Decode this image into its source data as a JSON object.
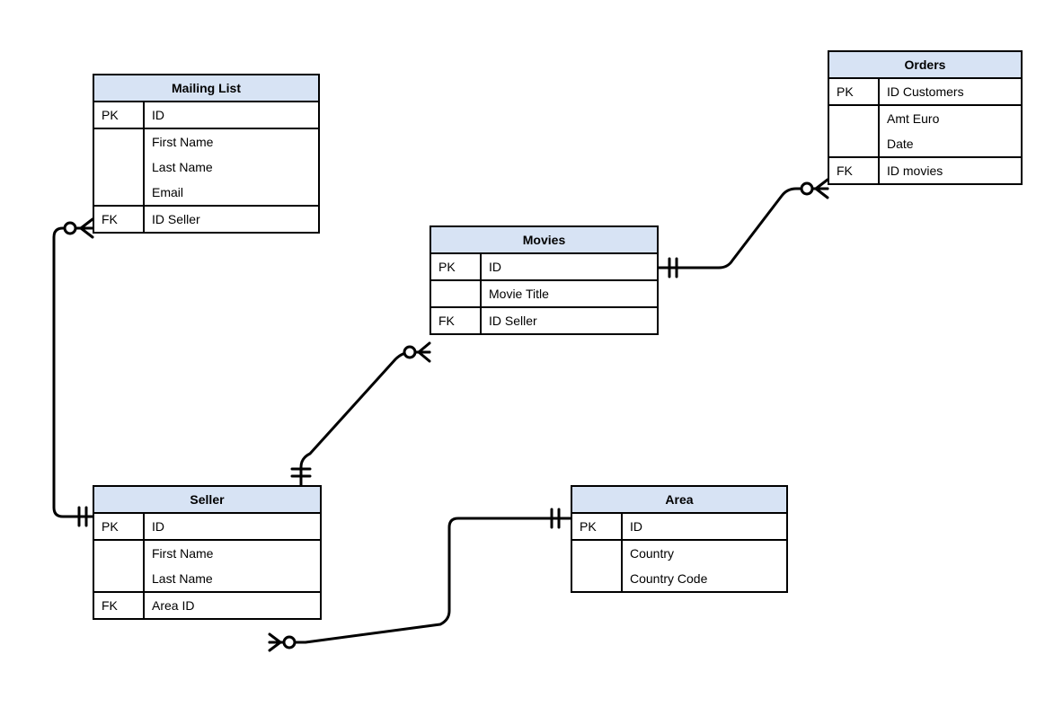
{
  "diagram_type": "entity-relationship",
  "entities": {
    "mailing_list": {
      "title": "Mailing List",
      "rows": [
        {
          "key": "PK",
          "field": "ID"
        },
        {
          "key": "",
          "field": "First Name"
        },
        {
          "key": "",
          "field": "Last Name"
        },
        {
          "key": "",
          "field": "Email"
        },
        {
          "key": "FK",
          "field": "ID Seller"
        }
      ]
    },
    "orders": {
      "title": "Orders",
      "rows": [
        {
          "key": "PK",
          "field": "ID Customers"
        },
        {
          "key": "",
          "field": "Amt Euro"
        },
        {
          "key": "",
          "field": "Date"
        },
        {
          "key": "FK",
          "field": "ID movies"
        }
      ]
    },
    "movies": {
      "title": "Movies",
      "rows": [
        {
          "key": "PK",
          "field": "ID"
        },
        {
          "key": "",
          "field": "Movie  Title"
        },
        {
          "key": "FK",
          "field": "ID Seller"
        }
      ]
    },
    "seller": {
      "title": "Seller",
      "rows": [
        {
          "key": "PK",
          "field": "ID"
        },
        {
          "key": "",
          "field": "First Name"
        },
        {
          "key": "",
          "field": "Last Name"
        },
        {
          "key": "FK",
          "field": "Area ID"
        }
      ]
    },
    "area": {
      "title": "Area",
      "rows": [
        {
          "key": "PK",
          "field": "ID"
        },
        {
          "key": "",
          "field": "Country"
        },
        {
          "key": "",
          "field": "Country Code"
        }
      ]
    }
  },
  "relationships": [
    {
      "from": "seller",
      "to": "mailing_list",
      "from_card": "one-mandatory",
      "to_card": "many-optional"
    },
    {
      "from": "seller",
      "to": "movies",
      "from_card": "one-mandatory",
      "to_card": "many-optional"
    },
    {
      "from": "movies",
      "to": "orders",
      "from_card": "one-mandatory",
      "to_card": "many-optional"
    },
    {
      "from": "area",
      "to": "seller",
      "from_card": "one-mandatory",
      "to_card": "many-optional"
    }
  ]
}
